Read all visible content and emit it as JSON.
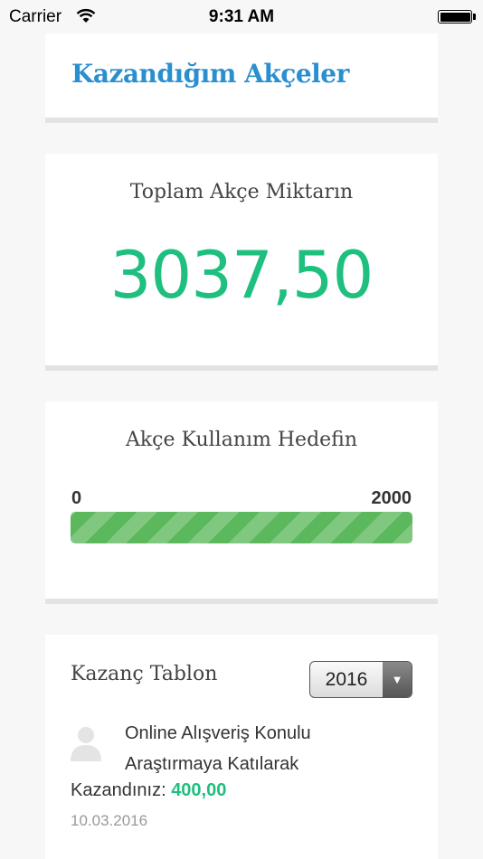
{
  "status_bar": {
    "carrier": "Carrier",
    "time": "9:31 AM"
  },
  "header": {
    "title": "Kazandığım Akçeler"
  },
  "total": {
    "heading": "Toplam Akçe Miktarın",
    "amount": "3037,50",
    "amount_color": "#1fbf7f"
  },
  "goal": {
    "heading": "Akçe Kullanım Hedefin",
    "min": "0",
    "max": "2000",
    "progress_fraction": 1.0,
    "bar_color": "#5cb85c"
  },
  "earnings_table": {
    "title": "Kazanç Tablon",
    "year_select": {
      "selected": "2016",
      "icon": "triangle-down-icon"
    },
    "items": [
      {
        "avatar_icon": "user-placeholder-icon",
        "description": "Online Alışveriş Konulu Araştırmaya Katılarak",
        "earned_label": "Kazandınız:",
        "earned_value": "400,00",
        "date": "10.03.2016"
      }
    ]
  },
  "colors": {
    "title_blue": "#2a8fcf",
    "accent_green": "#1fbf7f"
  }
}
